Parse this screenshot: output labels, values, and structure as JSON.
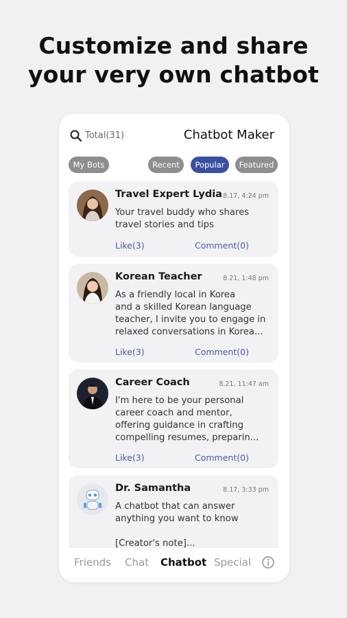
{
  "headline": {
    "line1": "Customize and share",
    "line2": "your very own chatbot"
  },
  "header": {
    "total": "Total(31)",
    "title": "Chatbot Maker"
  },
  "filters": {
    "my_bots": "My Bots",
    "recent": "Recent",
    "popular": "Popular",
    "featured": "Featured",
    "selected": "Popular"
  },
  "bots": [
    {
      "name": "Travel Expert Lydia",
      "date": "8.17, 4:24 pm",
      "description": "Your travel buddy who shares\ntravel stories and tips",
      "likes": "Like(3)",
      "comments": "Comment(0)"
    },
    {
      "name": "Korean Teacher",
      "date": "8.21, 1:48 pm",
      "description": "As a friendly local in Korea\nand a skilled Korean language\nteacher, I invite you to engage in\nrelaxed conversations in Korea...",
      "likes": "Like(3)",
      "comments": "Comment(0)"
    },
    {
      "name": "Career Coach",
      "date": "8.21, 11:47 am",
      "description": "I'm here to be your personal\ncareer coach and mentor,\noffering guidance in crafting\ncompelling resumes, preparin...",
      "likes": "Like(3)",
      "comments": "Comment(0)"
    },
    {
      "name": "Dr. Samantha",
      "date": "8.17, 3:33 pm",
      "description": "A chatbot that can answer\nanything you want to know\n\n[Creator's note]...",
      "likes": "",
      "comments": ""
    }
  ],
  "nav": {
    "friends": "Friends",
    "chat": "Chat",
    "chatbot": "Chatbot",
    "special": "Special",
    "active": "Chatbot"
  },
  "colors": {
    "accent": "#3a4fa0",
    "pill_inactive": "#8e8e8e",
    "card_bg": "#f2f2f4",
    "link": "#4b5aa6"
  },
  "icons": {
    "search": "search-icon",
    "info": "info-icon"
  }
}
